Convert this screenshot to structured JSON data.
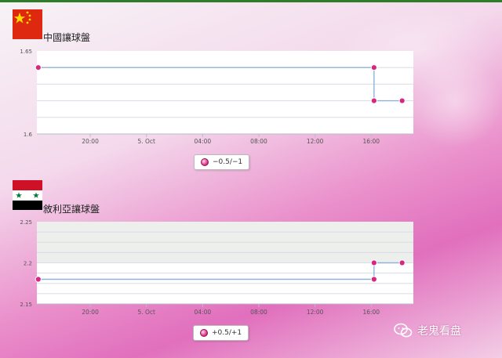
{
  "charts": [
    {
      "title": "中國讓球盤",
      "flag": "china",
      "legend_label": "−0.5/−1",
      "x_ticks": [
        "20:00",
        "5. Oct",
        "04:00",
        "08:00",
        "12:00",
        "16:00"
      ],
      "y_ticks": [
        "1.65",
        "1.6"
      ]
    },
    {
      "title": "敘利亞讓球盤",
      "flag": "syria",
      "legend_label": "+0.5/+1",
      "x_ticks": [
        "20:00",
        "5. Oct",
        "04:00",
        "08:00",
        "12:00",
        "16:00"
      ],
      "y_ticks": [
        "2.25",
        "2.2",
        "2.15"
      ]
    }
  ],
  "watermark": {
    "text": "老鬼看盘",
    "icon": "wechat-icon"
  },
  "colors": {
    "line": "#8fb3d9",
    "marker": "#d6287f",
    "grid": "#d9dce6",
    "top_border": "#2f7d28"
  },
  "chart_data": [
    {
      "type": "line",
      "title": "中國讓球盤",
      "x_ticks": [
        "20:00",
        "5. Oct",
        "04:00",
        "08:00",
        "12:00",
        "16:00"
      ],
      "x_tick_hours": [
        20,
        24,
        28,
        32,
        36,
        40
      ],
      "xlim_hours": [
        16.2,
        43
      ],
      "ylim": [
        1.6,
        1.65
      ],
      "y_ticks": [
        1.65,
        1.6
      ],
      "step": true,
      "grid": true,
      "legend_position": "bottom-center",
      "series": [
        {
          "name": "−0.5/−1",
          "points": [
            [
              16.3,
              1.64
            ],
            [
              40.2,
              1.64
            ],
            [
              40.2,
              1.62
            ],
            [
              42.2,
              1.62
            ]
          ]
        }
      ]
    },
    {
      "type": "line",
      "title": "敘利亞讓球盤",
      "x_ticks": [
        "20:00",
        "5. Oct",
        "04:00",
        "08:00",
        "12:00",
        "16:00"
      ],
      "x_tick_hours": [
        20,
        24,
        28,
        32,
        36,
        40
      ],
      "xlim_hours": [
        16.2,
        43
      ],
      "ylim": [
        2.15,
        2.25
      ],
      "y_ticks": [
        2.25,
        2.2,
        2.15
      ],
      "step": true,
      "grid": true,
      "legend_position": "bottom-center",
      "series": [
        {
          "name": "+0.5/+1",
          "points": [
            [
              16.3,
              2.18
            ],
            [
              40.2,
              2.18
            ],
            [
              40.2,
              2.2
            ],
            [
              42.2,
              2.2
            ]
          ]
        }
      ]
    }
  ]
}
